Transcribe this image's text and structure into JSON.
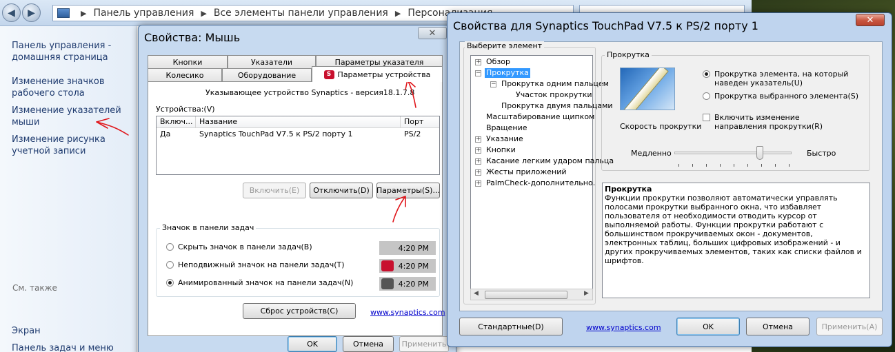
{
  "control_panel": {
    "breadcrumb": [
      "Панель управления",
      "Все элементы панели управления",
      "Персонализация"
    ],
    "left_links": [
      "Панель управления - домашняя страница",
      "Изменение значков рабочего стола",
      "Изменение указателей мыши",
      "Изменение рисунка учетной записи"
    ],
    "see_also_label": "См. также",
    "see_also_links": [
      "Экран",
      "Панель задач и меню"
    ]
  },
  "mouse_window": {
    "title": "Свойства: Мышь",
    "tabs_row1": [
      "Кнопки",
      "Указатели",
      "Параметры указателя"
    ],
    "tabs_row2": [
      "Колесико",
      "Оборудование",
      "Параметры устройства"
    ],
    "device_version": "Указывающее устройство Synaptics - версия18.1.7.8",
    "devices_label": "Устройства:(V)",
    "columns": [
      "Включ...",
      "Название",
      "Порт"
    ],
    "rows": [
      {
        "enabled": "Да",
        "name": "Synaptics TouchPad V7.5 к PS/2 порту 1",
        "port": "PS/2"
      }
    ],
    "btn_enable": "Включить(E)",
    "btn_disable": "Отключить(D)",
    "btn_params": "Параметры(S)...",
    "tray_group": "Значок в панели задач",
    "tray_options": [
      "Скрыть значок в панели задач(B)",
      "Неподвижный значок на панели задач(T)",
      "Анимированный значок на панели задач(N)"
    ],
    "clock": "4:20 PM",
    "btn_reset": "Сброс устройств(C)",
    "link": "www.synaptics.com",
    "btn_ok": "OK",
    "btn_cancel": "Отмена",
    "btn_apply": "Применить"
  },
  "synaptics_window": {
    "title": "Свойства для Synaptics TouchPad V7.5 к PS/2 порту 1",
    "tree_group": "Выберите элемент",
    "tree": [
      "Обзор",
      "Прокрутка",
      "Прокрутка одним пальцем",
      "Участок прокрутки",
      "Прокрутка двумя пальцами",
      "Масштабирование щипком",
      "Вращение",
      "Указание",
      "Кнопки",
      "Касание легким ударом пальца",
      "Жесты приложений",
      "PalmCheck-дополнительно."
    ],
    "scroll_group": "Прокрутка",
    "radio_under_pointer": "Прокрутка элемента, на который наведен указатель(U)",
    "radio_selected": "Прокрутка выбранного элемента(S)",
    "checkbox_reverse": "Включить изменение направления прокрутки(R)",
    "speed_label": "Скорость прокрутки",
    "slow": "Медленно",
    "fast": "Быстро",
    "desc_title": "Прокрутка",
    "desc_text": "Функции прокрутки позволяют автоматически управлять полосами прокрутки выбранного окна, что избавляет пользователя от необходимости отводить курсор от выполняемой работы. Функции прокрутки работают с большинством прокручиваемых окон - документов, электронных таблиц, больших цифровых изображений - и других прокручиваемых элементов, таких как списки файлов и шрифтов.",
    "btn_defaults": "Стандартные(D)",
    "link": "www.synaptics.com",
    "btn_ok": "OK",
    "btn_cancel": "Отмена",
    "btn_apply": "Применить(A)"
  },
  "colors": {
    "accent_red": "#e0161b",
    "selection_blue": "#3399ff",
    "link_blue": "#0000cc"
  }
}
